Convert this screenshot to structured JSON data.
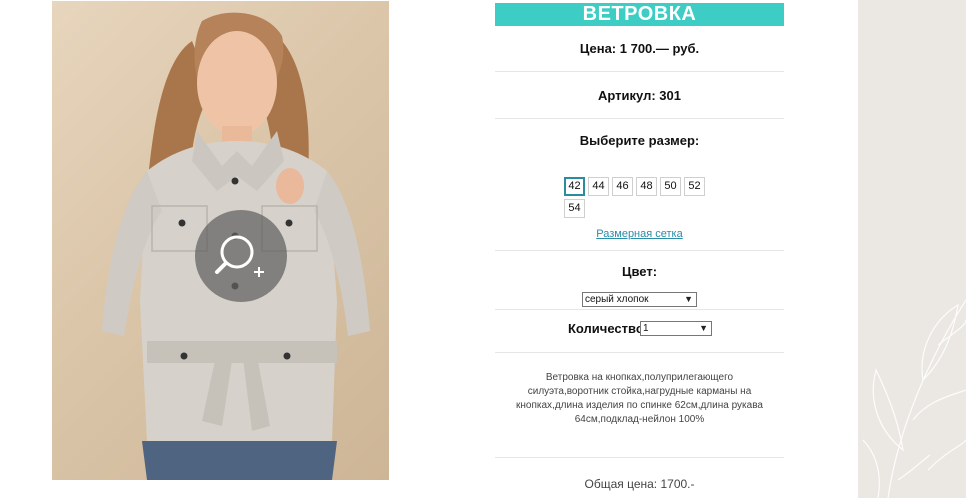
{
  "product": {
    "title": "ВЕТРОВКА",
    "price_text": "Цена: 1 700.— руб.",
    "sku_text": "Артикул: 301",
    "size_prompt": "Выберите размер:",
    "sizes": [
      "42",
      "44",
      "46",
      "48",
      "50",
      "52",
      "54"
    ],
    "selected_size": "42",
    "size_chart_link": "Размерная сетка",
    "color_label": "Цвет:",
    "color_value": "серый хлопок",
    "quantity_label": "Количество:",
    "quantity_value": "1",
    "description": "Ветровка на кнопках,полуприлегающего силуэта,воротник стойка,нагрудные карманы на кнопках,длина изделия по спинке 62см,длина рукава 64см,подклад-нейлон 100%",
    "total_text": "Общая цена: 1700.-"
  },
  "icons": {
    "zoom": "magnifier-plus-icon",
    "dropdown": "chevron-down-icon"
  },
  "colors": {
    "accent": "#3dcdc4",
    "link": "#2a8ca8",
    "side_panel": "#ebe8e3"
  }
}
